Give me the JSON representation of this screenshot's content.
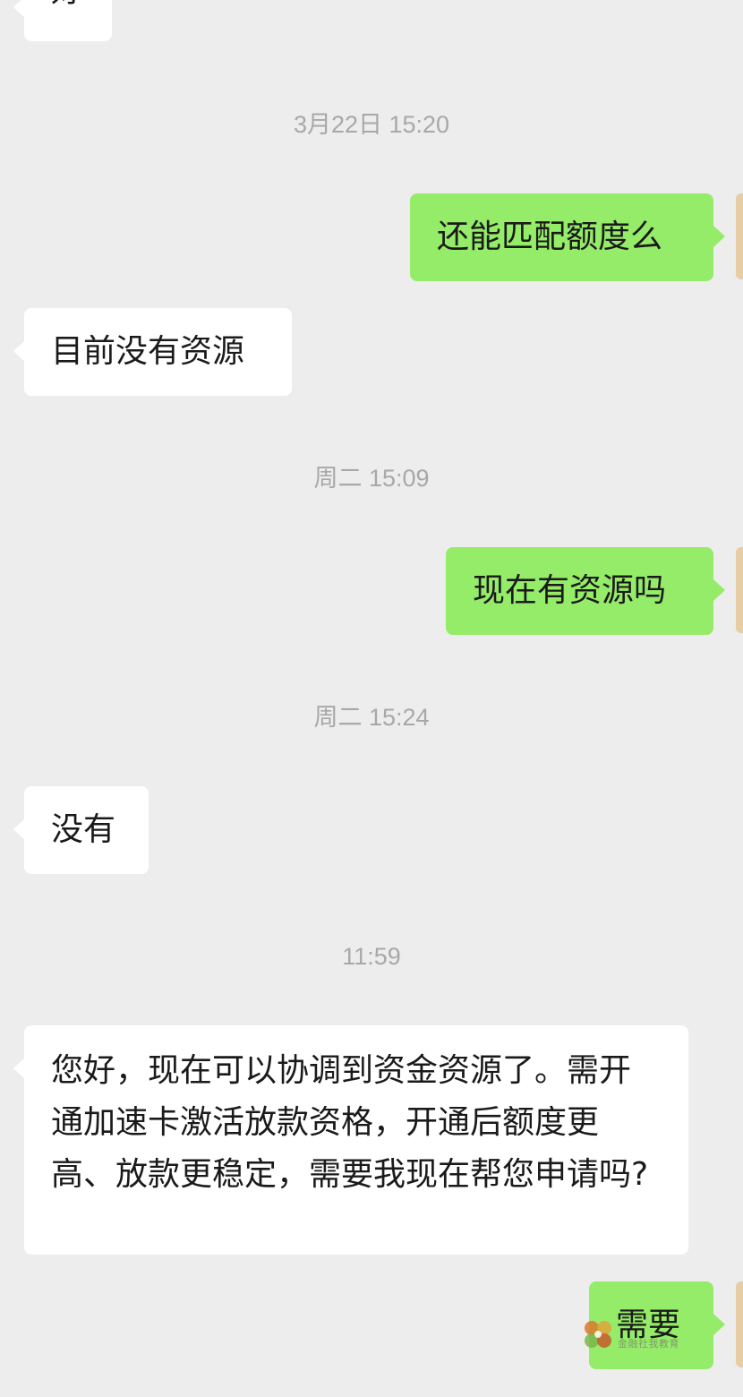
{
  "messages": {
    "top_partial": {
      "text": "好",
      "direction": "incoming"
    },
    "ts1": "3月22日 15:20",
    "m1": {
      "text": "还能匹配额度么",
      "direction": "outgoing"
    },
    "m2": {
      "text": "目前没有资源",
      "direction": "incoming"
    },
    "ts2": "周二 15:09",
    "m3": {
      "text": "现在有资源吗",
      "direction": "outgoing"
    },
    "ts3": "周二 15:24",
    "m4": {
      "text": "没有",
      "direction": "incoming"
    },
    "ts4": "11:59",
    "m5": {
      "text": "您好，现在可以协调到资金资源了。需开通加速卡激活放款资格，开通后额度更高、放款更稳定，需要我现在帮您申请吗?",
      "direction": "incoming"
    },
    "m6": {
      "text": "需要",
      "direction": "outgoing"
    }
  },
  "watermark": {
    "text": "金融社我教育",
    "icon": "clover-logo-icon"
  },
  "colors": {
    "background": "#ededed",
    "incoming_bubble": "#ffffff",
    "outgoing_bubble": "#95ec69",
    "timestamp": "#a8a8a8",
    "avatar_edge": "#e6cda3"
  }
}
